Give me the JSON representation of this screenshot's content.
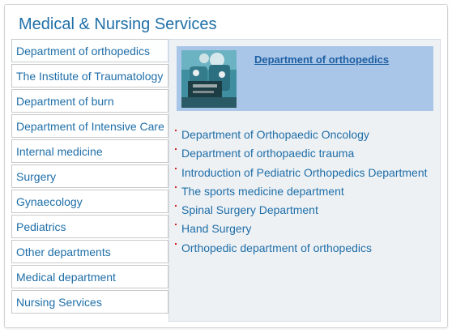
{
  "section": {
    "title": "Medical & Nursing Services"
  },
  "nav": {
    "items": [
      {
        "label": "Department of orthopedics"
      },
      {
        "label": "The Institute of Traumatology"
      },
      {
        "label": "Department of burn"
      },
      {
        "label": "Department of Intensive Care"
      },
      {
        "label": "Internal medicine"
      },
      {
        "label": "Surgery"
      },
      {
        "label": "Gynaecology"
      },
      {
        "label": "Pediatrics"
      },
      {
        "label": "Other departments"
      },
      {
        "label": "Medical department"
      },
      {
        "label": "Nursing Services"
      }
    ]
  },
  "content": {
    "heading_link": "Department of orthopedics",
    "links": [
      "Department of Orthopaedic Oncology",
      "Department of orthopaedic trauma",
      "Introduction of Pediatric Orthopedics Department",
      "The sports medicine department",
      "Spinal Surgery Department",
      "Hand Surgery",
      "Orthopedic department of orthopedics"
    ]
  },
  "colors": {
    "accent": "#1f6fa8",
    "banner": "#a9c6e8",
    "bullet": "#d02020"
  }
}
